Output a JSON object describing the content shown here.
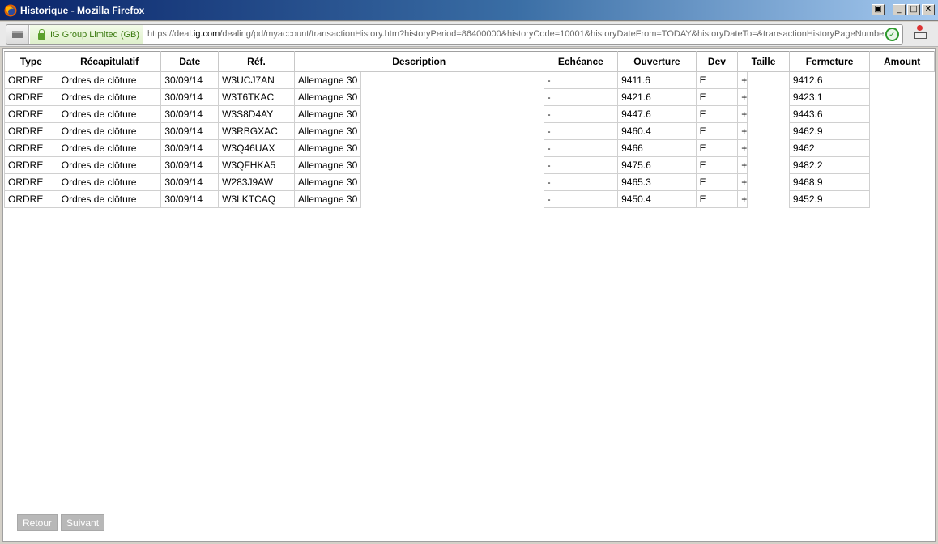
{
  "window": {
    "title": "Historique - Mozilla Firefox"
  },
  "navbar": {
    "identity_label": "IG Group Limited (GB)",
    "url_prefix": "https://deal.",
    "url_domain": "ig.com",
    "url_rest": "/dealing/pd/myaccount/transactionHistory.htm?historyPeriod=86400000&historyCode=10001&historyDateFrom=TODAY&historyDateTo=&transactionHistoryPageNumber"
  },
  "table": {
    "headers": {
      "type": "Type",
      "recap": "Récapitulatif",
      "date": "Date",
      "ref": "Réf.",
      "description": "Description",
      "echeance": "Echéance",
      "ouverture": "Ouverture",
      "dev": "Dev",
      "taille": "Taille",
      "fermeture": "Fermeture",
      "amount": "Amount"
    },
    "rows": [
      {
        "type": "ORDRE",
        "recap": "Ordres de clôture",
        "date": "30/09/14",
        "ref": "W3UCJ7AN",
        "description": "Allemagne 30",
        "echeance": "-",
        "ouverture": "9411.6",
        "dev": "E",
        "taille": "+",
        "fermeture": "9412.6"
      },
      {
        "type": "ORDRE",
        "recap": "Ordres de clôture",
        "date": "30/09/14",
        "ref": "W3T6TKAC",
        "description": "Allemagne 30",
        "echeance": "-",
        "ouverture": "9421.6",
        "dev": "E",
        "taille": "+",
        "fermeture": "9423.1"
      },
      {
        "type": "ORDRE",
        "recap": "Ordres de clôture",
        "date": "30/09/14",
        "ref": "W3S8D4AY",
        "description": "Allemagne 30",
        "echeance": "-",
        "ouverture": "9447.6",
        "dev": "E",
        "taille": "+",
        "fermeture": "9443.6"
      },
      {
        "type": "ORDRE",
        "recap": "Ordres de clôture",
        "date": "30/09/14",
        "ref": "W3RBGXAC",
        "description": "Allemagne 30",
        "echeance": "-",
        "ouverture": "9460.4",
        "dev": "E",
        "taille": "+",
        "fermeture": "9462.9"
      },
      {
        "type": "ORDRE",
        "recap": "Ordres de clôture",
        "date": "30/09/14",
        "ref": "W3Q46UAX",
        "description": "Allemagne 30",
        "echeance": "-",
        "ouverture": "9466",
        "dev": "E",
        "taille": "+",
        "fermeture": "9462"
      },
      {
        "type": "ORDRE",
        "recap": "Ordres de clôture",
        "date": "30/09/14",
        "ref": "W3QFHKA5",
        "description": "Allemagne 30",
        "echeance": "-",
        "ouverture": "9475.6",
        "dev": "E",
        "taille": "+",
        "fermeture": "9482.2"
      },
      {
        "type": "ORDRE",
        "recap": "Ordres de clôture",
        "date": "30/09/14",
        "ref": "W283J9AW",
        "description": "Allemagne 30",
        "echeance": "-",
        "ouverture": "9465.3",
        "dev": "E",
        "taille": "+",
        "fermeture": "9468.9"
      },
      {
        "type": "ORDRE",
        "recap": "Ordres de clôture",
        "date": "30/09/14",
        "ref": "W3LKTCAQ",
        "description": "Allemagne 30",
        "echeance": "-",
        "ouverture": "9450.4",
        "dev": "E",
        "taille": "+",
        "fermeture": "9452.9"
      }
    ]
  },
  "pager": {
    "back_label": "Retour",
    "next_label": "Suivant"
  }
}
